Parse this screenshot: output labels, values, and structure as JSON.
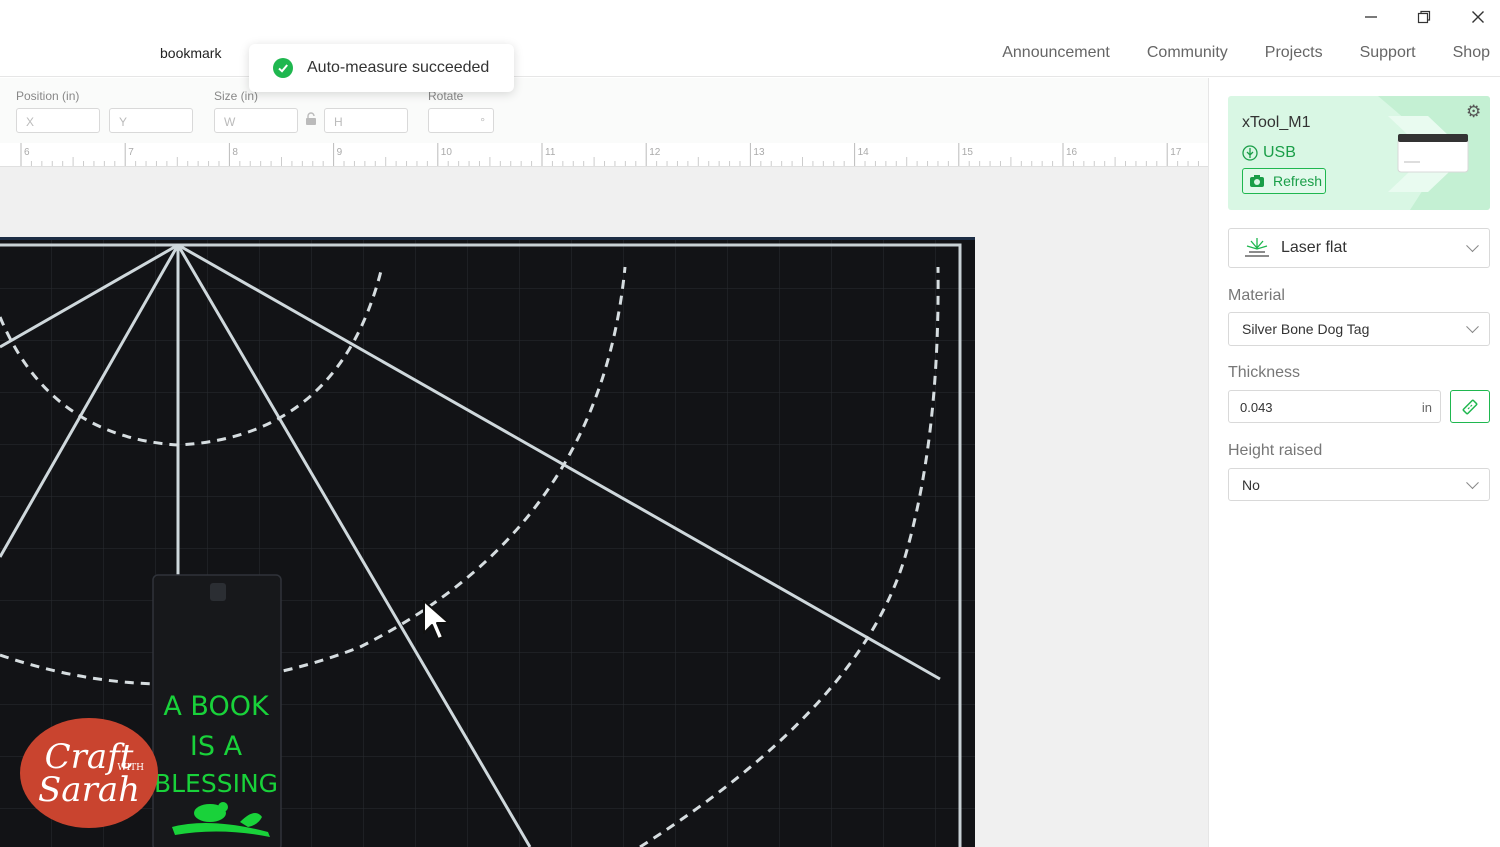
{
  "document": {
    "title": "bookmark"
  },
  "nav": {
    "items": [
      "Announcement",
      "Community",
      "Projects",
      "Support",
      "Shop"
    ]
  },
  "window_controls": {
    "minimize": "minimize-icon",
    "restore": "restore-icon",
    "close": "close-icon"
  },
  "toast": {
    "message": "Auto-measure succeeded",
    "status_color": "#1fb74f"
  },
  "toolbar": {
    "position_label": "Position (in)",
    "x_placeholder": "X",
    "y_placeholder": "Y",
    "size_label": "Size (in)",
    "w_placeholder": "W",
    "h_placeholder": "H",
    "rotate_label": "Rotate",
    "rotate_unit": "°"
  },
  "ruler": {
    "ticks": [
      "6",
      "7",
      "8",
      "9",
      "10",
      "11",
      "12",
      "13",
      "14",
      "15",
      "16",
      "17"
    ]
  },
  "canvas": {
    "bookmark_text": [
      "A BOOK",
      "IS A",
      "BLESSING"
    ],
    "text_color": "#19d23a"
  },
  "device": {
    "name": "xTool_M1",
    "connection": "USB",
    "refresh_label": "Refresh",
    "accent": "#1fb74f"
  },
  "settings": {
    "mode": "Laser flat",
    "material_label": "Material",
    "material_value": "Silver Bone Dog Tag",
    "thickness_label": "Thickness",
    "thickness_value": "0.043",
    "thickness_unit": "in",
    "height_label": "Height raised",
    "height_value": "No"
  },
  "logo": {
    "line1": "Craft",
    "line2": "WITH",
    "line3": "Sarah"
  }
}
